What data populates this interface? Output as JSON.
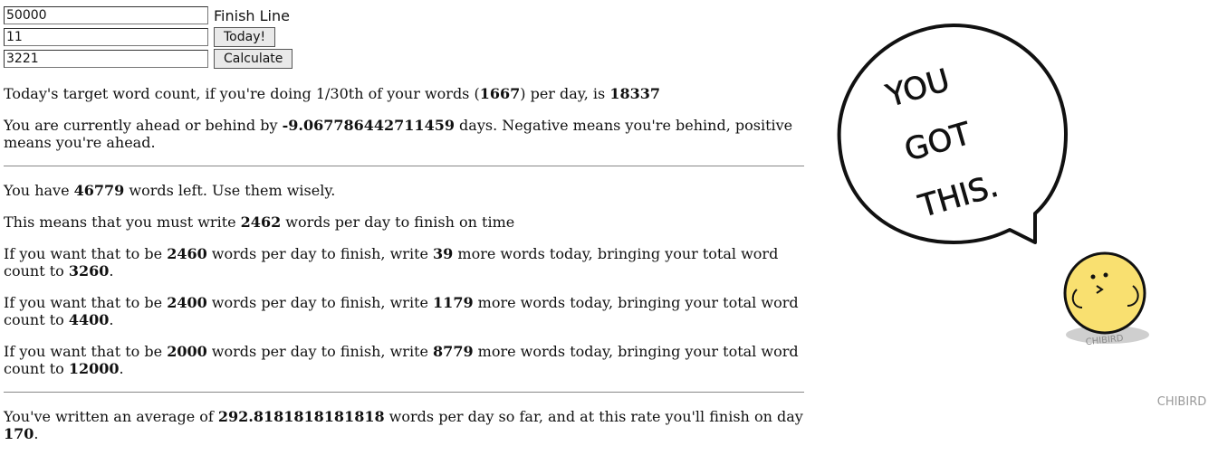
{
  "form": {
    "finish_value": "50000",
    "finish_label": "Finish Line",
    "day_value": "11",
    "today_button": "Today!",
    "words_value": "3221",
    "calculate_button": "Calculate"
  },
  "target": {
    "pre": "Today's target word count, if you're doing 1/30th of your words (",
    "per_day": "1667",
    "mid": ") per day, is ",
    "value": "18337"
  },
  "ahead": {
    "pre": "You are currently ahead or behind by ",
    "days": "-9.067786442711459",
    "post": " days. Negative means you're behind, positive means you're ahead."
  },
  "left": {
    "pre": "You have ",
    "value": "46779",
    "post": " words left. Use them wisely."
  },
  "must": {
    "pre": "This means that you must write ",
    "value": "2462",
    "post": " words per day to finish on time"
  },
  "scenarios": [
    {
      "rate": "2460",
      "more": "39",
      "total": "3260"
    },
    {
      "rate": "2400",
      "more": "1179",
      "total": "4400"
    },
    {
      "rate": "2000",
      "more": "8779",
      "total": "12000"
    }
  ],
  "scenario_text": {
    "pre": "If you want that to be ",
    "mid1": " words per day to finish, write ",
    "mid2": " more words today, bringing your total word count to ",
    "end": "."
  },
  "average": {
    "pre": "You've written an average of ",
    "value": "292.8181818181818",
    "mid": " words per day so far, and at this rate you'll finish on day ",
    "day": "170",
    "end": "."
  },
  "art": {
    "bubble_lines": [
      "YOU",
      "GOT",
      "THIS."
    ],
    "shadow_text": "CHIBIRD",
    "signature": "CHIBIRD"
  }
}
